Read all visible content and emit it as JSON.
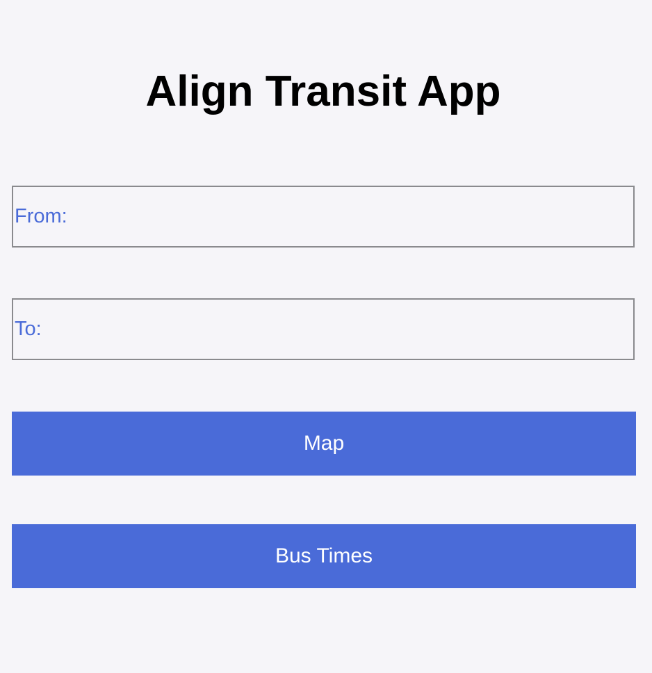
{
  "app": {
    "title": "Align Transit App"
  },
  "form": {
    "from_placeholder": "From:",
    "from_value": "",
    "to_placeholder": "To:",
    "to_value": ""
  },
  "actions": {
    "map_label": "Map",
    "bus_times_label": "Bus Times"
  },
  "colors": {
    "accent": "#4a6bd8",
    "background": "#f6f5f9",
    "input_border": "#8a8a8e"
  }
}
